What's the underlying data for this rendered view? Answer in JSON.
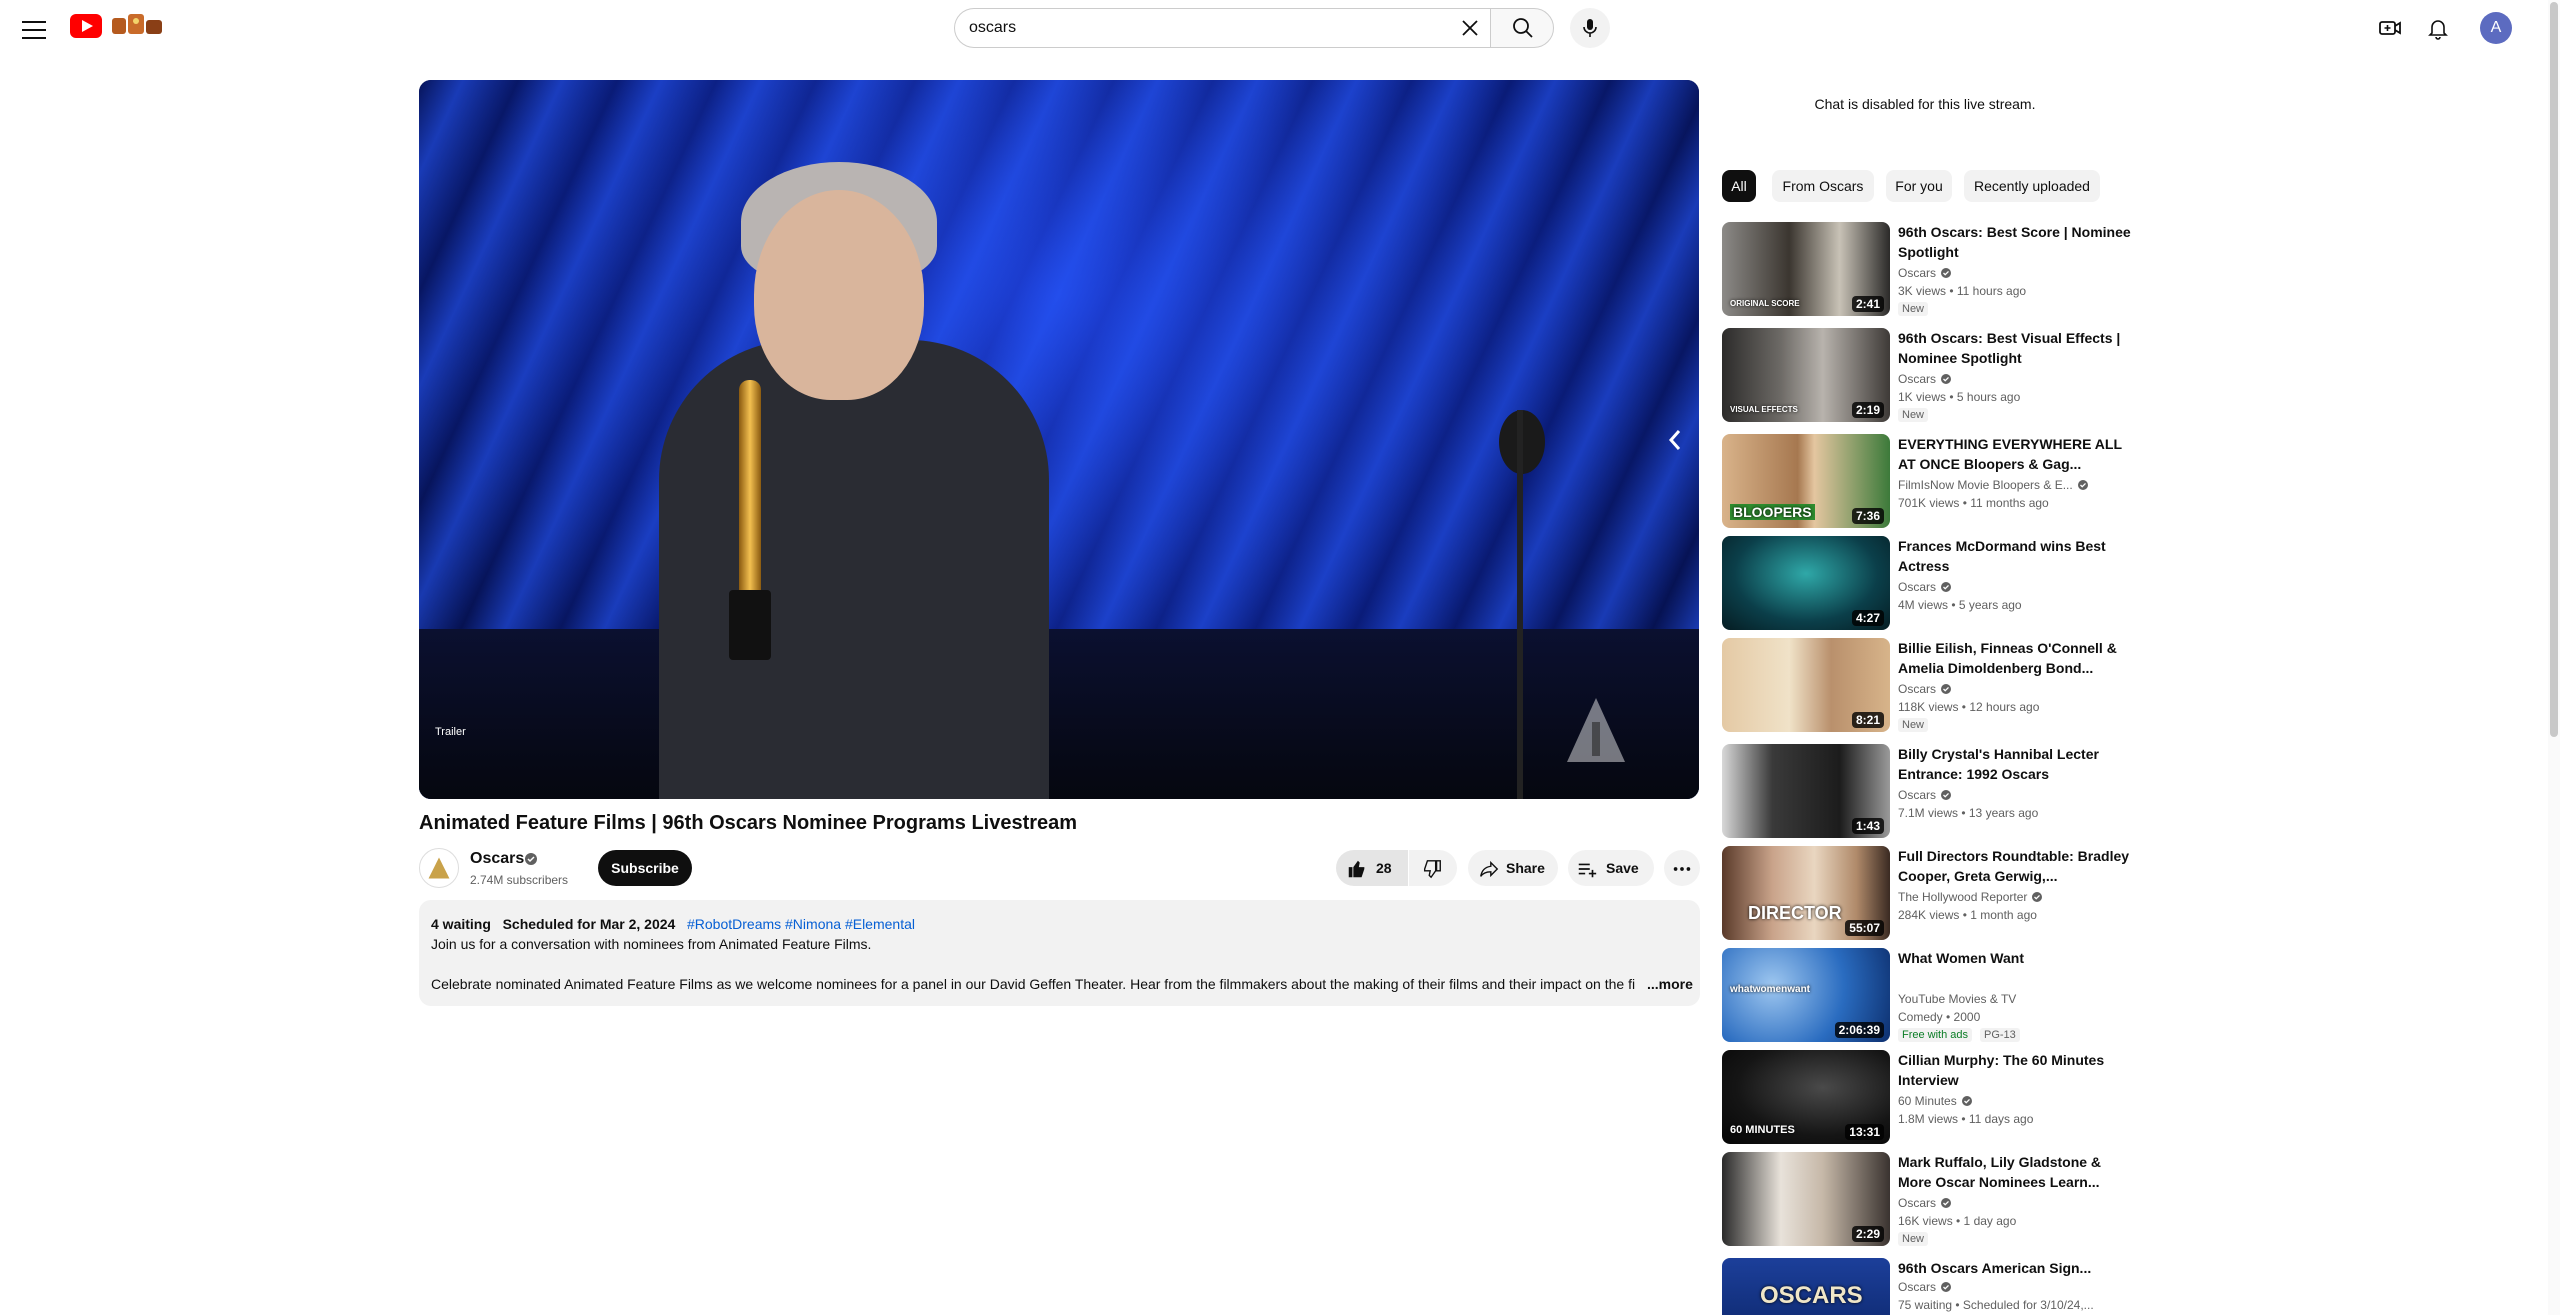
{
  "header": {
    "search_value": "oscars",
    "avatar_letter": "A"
  },
  "player": {
    "overlay_label": "Trailer"
  },
  "video": {
    "title": "Animated Feature Films | 96th Oscars Nominee Programs Livestream",
    "channel": "Oscars",
    "subscribers": "2.74M subscribers",
    "subscribe_label": "Subscribe",
    "likes": "28",
    "share_label": "Share",
    "save_label": "Save",
    "waiting": "4 waiting",
    "scheduled": "Scheduled for Mar 2, 2024",
    "tags": "#RobotDreams #Nimona #Elemental",
    "desc_line1": "Join us for a conversation with nominees from Animated Feature Films.",
    "desc_line2": "Celebrate nominated Animated Feature Films as we welcome nominees for a panel in our David Geffen Theater. Hear from the filmmakers about the making of their films and their impact on the fi",
    "more_label": "...more"
  },
  "sidebar": {
    "chat_note": "Chat is disabled for this live stream.",
    "chips": [
      "All",
      "From Oscars",
      "For you",
      "Recently uploaded"
    ],
    "items": [
      {
        "title": "96th Oscars: Best Score | Nominee Spotlight",
        "channel": "Oscars",
        "stats": "3K views • 11 hours ago",
        "badge": "New",
        "duration": "2:41",
        "thumb_label": "ORIGINAL SCORE"
      },
      {
        "title": "96th Oscars: Best Visual Effects | Nominee Spotlight",
        "channel": "Oscars",
        "stats": "1K views • 5 hours ago",
        "badge": "New",
        "duration": "2:19",
        "thumb_label": "VISUAL EFFECTS"
      },
      {
        "title": "EVERYTHING EVERYWHERE ALL AT ONCE Bloopers & Gag...",
        "channel": "FilmIsNow Movie Bloopers & E...",
        "stats": "701K views • 11 months ago",
        "badge": "",
        "duration": "7:36",
        "thumb_label": "BLOOPERS"
      },
      {
        "title": "Frances McDormand wins Best Actress",
        "channel": "Oscars",
        "stats": "4M views • 5 years ago",
        "badge": "",
        "duration": "4:27",
        "thumb_label": ""
      },
      {
        "title": "Billie Eilish, Finneas O'Connell & Amelia Dimoldenberg Bond...",
        "channel": "Oscars",
        "stats": "118K views • 12 hours ago",
        "badge": "New",
        "duration": "8:21",
        "thumb_label": ""
      },
      {
        "title": "Billy Crystal's Hannibal Lecter Entrance: 1992 Oscars",
        "channel": "Oscars",
        "stats": "7.1M views • 13 years ago",
        "badge": "",
        "duration": "1:43",
        "thumb_label": ""
      },
      {
        "title": "Full Directors Roundtable: Bradley Cooper, Greta Gerwig,...",
        "channel": "The Hollywood Reporter",
        "stats": "284K views • 1 month ago",
        "badge": "",
        "duration": "55:07",
        "thumb_label": "DIRECTOR"
      },
      {
        "title": "What Women Want",
        "channel": "YouTube Movies & TV",
        "stats": "Comedy • 2000",
        "badge": "Free with ads",
        "badge2": "PG-13",
        "duration": "2:06:39",
        "thumb_label": "whatwomenwant"
      },
      {
        "title": "Cillian Murphy: The 60 Minutes Interview",
        "channel": "60 Minutes",
        "stats": "1.8M views • 11 days ago",
        "badge": "",
        "duration": "13:31",
        "thumb_label": "60 MINUTES"
      },
      {
        "title": "Mark Ruffalo, Lily Gladstone & More Oscar Nominees Learn...",
        "channel": "Oscars",
        "stats": "16K views • 1 day ago",
        "badge": "New",
        "duration": "2:29",
        "thumb_label": ""
      },
      {
        "title": "96th Oscars American Sign...",
        "channel": "Oscars",
        "stats": "75 waiting • Scheduled for 3/10/24,...",
        "badge": "",
        "duration": "",
        "thumb_label": "OSCARS"
      }
    ]
  }
}
